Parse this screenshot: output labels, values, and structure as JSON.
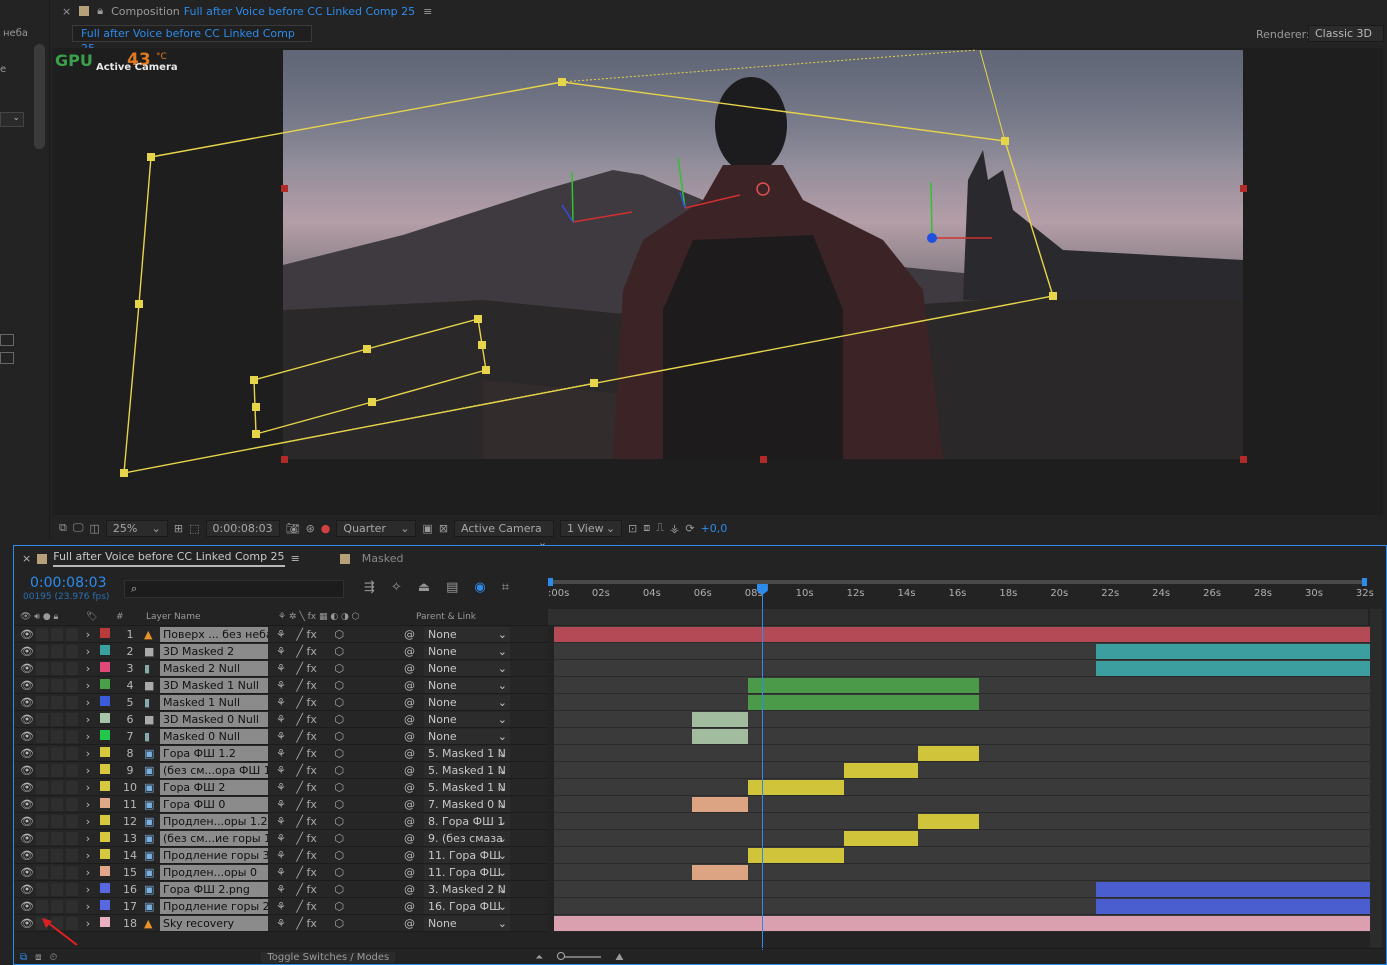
{
  "left_panel": {
    "label": "неба",
    "small_label": "е"
  },
  "comp_tab": {
    "close": "×",
    "prefix": "Composition",
    "name": "Full after Voice before CC Linked Comp 25",
    "menu": "≡"
  },
  "viewer": {
    "breadcrumb": "Full after Voice before CC Linked Comp 25",
    "renderer_label": "Renderer:",
    "renderer_value": "Classic 3D",
    "gpu_label": "GPU",
    "gpu_temp": "43",
    "gpu_unit": "°C",
    "camera_overlay": "Active Camera"
  },
  "comp_toolbar": {
    "zoom": "25%",
    "timecode": "0:00:08:03",
    "resolution": "Quarter",
    "camera": "Active Camera",
    "views": "1 View",
    "exposure": "+0,0"
  },
  "timeline": {
    "tabs": [
      {
        "label": "Full after Voice before CC Linked Comp 25",
        "active": true
      },
      {
        "label": "Masked",
        "active": false
      }
    ],
    "timecode": "0:00:08:03",
    "frames": "00195 (23.976 fps)",
    "search_placeholder": "",
    "col_num": "#",
    "col_layer": "Layer Name",
    "col_parent": "Parent & Link",
    "toggle_label": "Toggle Switches / Modes",
    "ruler": [
      ":00s",
      "02s",
      "04s",
      "06s",
      "08s",
      "10s",
      "12s",
      "14s",
      "16s",
      "18s",
      "20s",
      "22s",
      "24s",
      "26s",
      "28s",
      "30s",
      "32s"
    ],
    "playhead_seconds": 8.125,
    "duration_seconds": 32.2,
    "layers": [
      {
        "num": "1",
        "name": "Поверх ... без неба",
        "color": "#b83a3a",
        "icon": "cone",
        "parent": "None",
        "in": 0,
        "out": 32.2,
        "bar": "#b44a56"
      },
      {
        "num": "2",
        "name": "3D Masked 2",
        "color": "#3aa0a0",
        "icon": "camera",
        "parent": "None",
        "in": 21.3,
        "out": 32.2,
        "bar": "#3c9e9e"
      },
      {
        "num": "3",
        "name": "Masked 2 Null",
        "color": "#e04a78",
        "icon": "solid",
        "parent": "None",
        "in": 21.3,
        "out": 32.2,
        "bar": "#3c9e9e"
      },
      {
        "num": "4",
        "name": "3D Masked 1 Null",
        "color": "#4aa04a",
        "icon": "camera",
        "parent": "None",
        "in": 7.6,
        "out": 16.7,
        "bar": "#4a9a4a"
      },
      {
        "num": "5",
        "name": "Masked 1 Null",
        "color": "#3b5bd8",
        "icon": "solid",
        "parent": "None",
        "in": 7.6,
        "out": 16.7,
        "bar": "#4a9a4a"
      },
      {
        "num": "6",
        "name": "3D Masked 0 Null",
        "color": "#a8c4a8",
        "icon": "camera",
        "parent": "None",
        "in": 5.4,
        "out": 7.6,
        "bar": "#a2bca0"
      },
      {
        "num": "7",
        "name": "Masked 0 Null",
        "color": "#22c84a",
        "icon": "solid",
        "parent": "None",
        "in": 5.4,
        "out": 7.6,
        "bar": "#a2bca0"
      },
      {
        "num": "8",
        "name": "Гора ФШ 1.2",
        "color": "#d8c840",
        "icon": "image",
        "parent": "5. Masked 1 N",
        "in": 14.3,
        "out": 16.7,
        "bar": "#cfc43a"
      },
      {
        "num": "9",
        "name": "(без см...ора ФШ 1",
        "color": "#d8c840",
        "icon": "image",
        "parent": "5. Masked 1 N",
        "in": 11.4,
        "out": 14.3,
        "bar": "#cfc43a"
      },
      {
        "num": "10",
        "name": "Гора ФШ 2",
        "color": "#d8c840",
        "icon": "image",
        "parent": "5. Masked 1 N",
        "in": 7.6,
        "out": 11.4,
        "bar": "#cfc43a"
      },
      {
        "num": "11",
        "name": "Гора ФШ 0",
        "color": "#e0a888",
        "icon": "image",
        "parent": "7. Masked 0 N",
        "in": 5.4,
        "out": 7.6,
        "bar": "#dca482"
      },
      {
        "num": "12",
        "name": "Продлен...оры 1.2",
        "color": "#d8c840",
        "icon": "image",
        "parent": "8. Гора ФШ 1",
        "in": 14.3,
        "out": 16.7,
        "bar": "#cfc43a"
      },
      {
        "num": "13",
        "name": "(без см...ие горы 1",
        "color": "#d8c840",
        "icon": "image",
        "parent": "9. (без смаза",
        "in": 11.4,
        "out": 14.3,
        "bar": "#cfc43a"
      },
      {
        "num": "14",
        "name": "Продление горы 3",
        "color": "#d8c840",
        "icon": "image",
        "parent": "11. Гора ФШ",
        "in": 7.6,
        "out": 11.4,
        "bar": "#cfc43a"
      },
      {
        "num": "15",
        "name": "Продлен...оры 0",
        "color": "#e0a888",
        "icon": "image",
        "parent": "11. Гора ФШ",
        "in": 5.4,
        "out": 7.6,
        "bar": "#dca482"
      },
      {
        "num": "16",
        "name": "Гора ФШ 2.png",
        "color": "#5868e0",
        "icon": "image",
        "parent": "3. Masked 2 N",
        "in": 21.3,
        "out": 32.2,
        "bar": "#4a5ed0"
      },
      {
        "num": "17",
        "name": "Продление горы 2",
        "color": "#5868e0",
        "icon": "image",
        "parent": "16. Гора ФШ",
        "in": 21.3,
        "out": 32.2,
        "bar": "#4a5ed0"
      },
      {
        "num": "18",
        "name": "Sky recovery",
        "color": "#e8b0c0",
        "icon": "cone",
        "parent": "None",
        "in": 0,
        "out": 32.2,
        "bar": "#dba0b0"
      }
    ]
  }
}
